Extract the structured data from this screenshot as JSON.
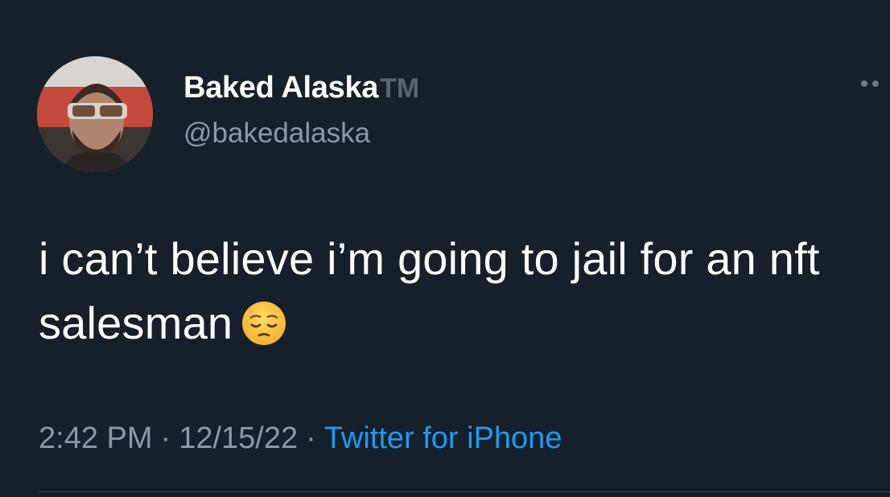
{
  "author": {
    "display_name": "Baked Alaska",
    "trademark": "TM",
    "handle": "@bakedalaska",
    "avatar_icon": "profile-photo"
  },
  "tweet": {
    "text": "i can’t believe i’m going to jail for an nft salesman",
    "emoji_icon": "pensive-face-emoji"
  },
  "meta": {
    "time": "2:42 PM",
    "separator": "·",
    "date": "12/15/22",
    "source": "Twitter for iPhone"
  },
  "colors": {
    "background": "#15202b",
    "text": "#ffffff",
    "secondary": "#8b98a5",
    "link": "#1d9bf0"
  }
}
